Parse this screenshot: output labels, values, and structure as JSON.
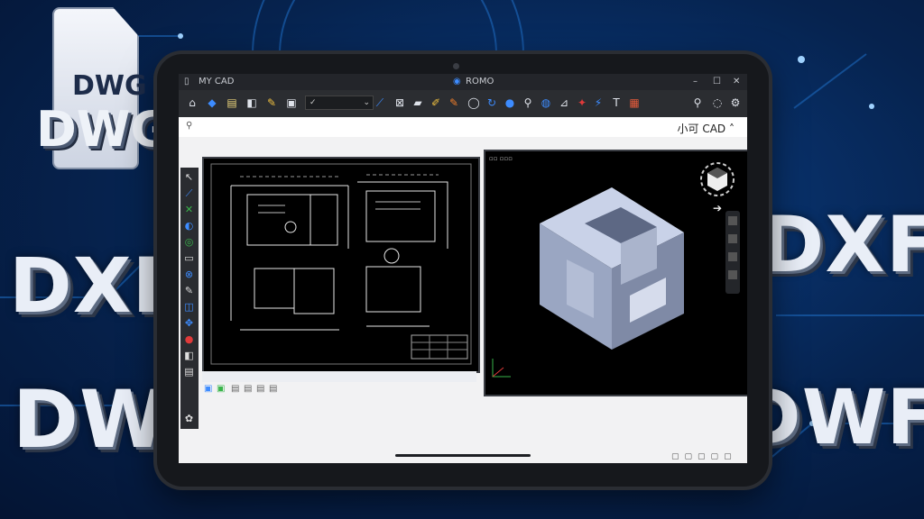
{
  "background_formats": {
    "dwg_small": "DWG",
    "dwg_big": "DWG",
    "dxf_left": "DXF",
    "dw": "DW",
    "dxf_right": "DXF",
    "dwf": "DWF"
  },
  "window": {
    "title": "MY CAD",
    "center_title": "ROMO"
  },
  "app": {
    "name": "小可 CAD",
    "chevron": "˄"
  },
  "icons": {
    "search": "search-icon",
    "minimize": "minimize-icon",
    "maximize": "maximize-icon",
    "close": "close-icon"
  },
  "colors": {
    "background": "#06234f",
    "accent": "#0a84ff",
    "titlebar": "#23252a",
    "ribbon": "#2b2d31",
    "drawing": "#000000",
    "model": "#c9d2e8"
  }
}
